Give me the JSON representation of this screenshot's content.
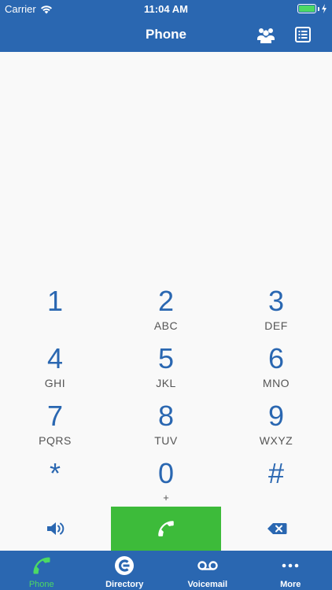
{
  "status_bar": {
    "carrier": "Carrier",
    "time": "11:04 AM",
    "battery_level": 1.0
  },
  "nav": {
    "title": "Phone",
    "right_icons": [
      "contacts-group-icon",
      "call-list-icon"
    ]
  },
  "keypad": [
    {
      "digit": "1",
      "letters": ""
    },
    {
      "digit": "2",
      "letters": "ABC"
    },
    {
      "digit": "3",
      "letters": "DEF"
    },
    {
      "digit": "4",
      "letters": "GHI"
    },
    {
      "digit": "5",
      "letters": "JKL"
    },
    {
      "digit": "6",
      "letters": "MNO"
    },
    {
      "digit": "7",
      "letters": "PQRS"
    },
    {
      "digit": "8",
      "letters": "TUV"
    },
    {
      "digit": "9",
      "letters": "WXYZ"
    },
    {
      "digit": "*",
      "letters": ""
    },
    {
      "digit": "0",
      "letters": "+"
    },
    {
      "digit": "#",
      "letters": ""
    }
  ],
  "actions": {
    "left_icon": "speaker-icon",
    "center_icon": "phone-handset-icon",
    "right_icon": "backspace-icon"
  },
  "tabs": [
    {
      "label": "Phone",
      "icon": "phone-handset-icon",
      "active": true
    },
    {
      "label": "Directory",
      "icon": "directory-icon",
      "active": false
    },
    {
      "label": "Voicemail",
      "icon": "voicemail-icon",
      "active": false
    },
    {
      "label": "More",
      "icon": "more-dots-icon",
      "active": false
    }
  ],
  "colors": {
    "brand_blue": "#2a67b1",
    "call_green": "#3dbb3a",
    "active_tab_green": "#4cd964",
    "background": "#f9f9f9"
  }
}
